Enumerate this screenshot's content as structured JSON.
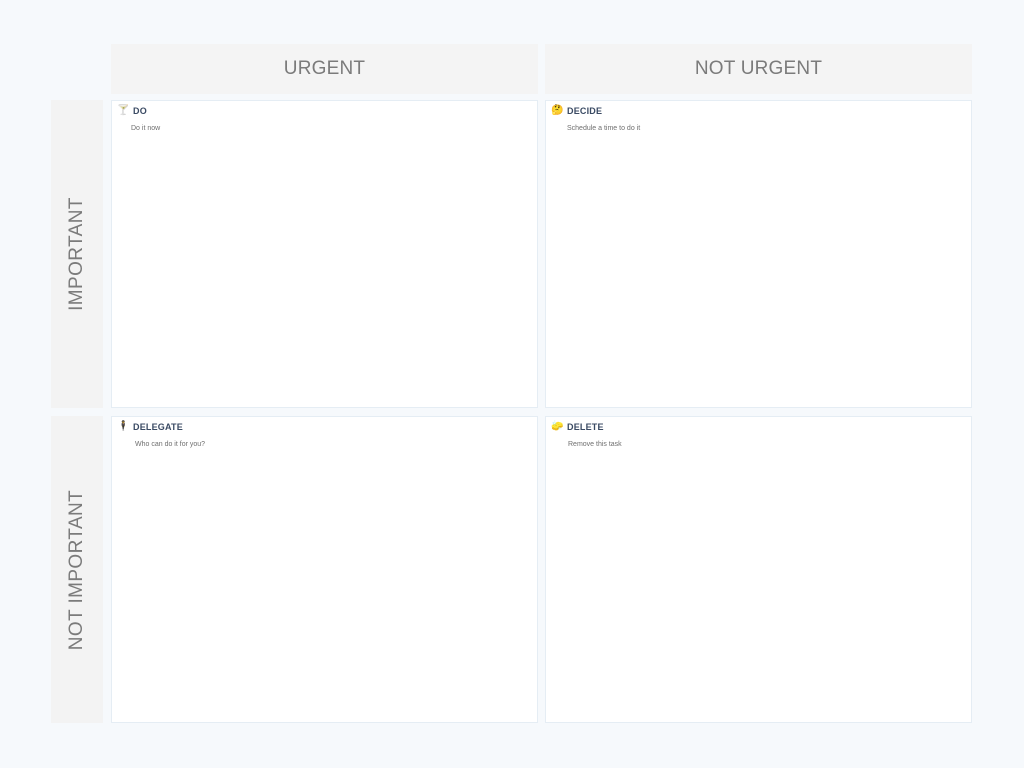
{
  "columns": {
    "urgent": "URGENT",
    "not_urgent": "NOT URGENT"
  },
  "rows": {
    "important": "IMPORTANT",
    "not_important": "NOT IMPORTANT"
  },
  "quadrants": {
    "do": {
      "icon": "cocktail-icon",
      "glyph": "🍸",
      "title": "DO",
      "subtitle": "Do it now"
    },
    "decide": {
      "icon": "thinking-face-icon",
      "glyph": "🤔",
      "title": "DECIDE",
      "subtitle": "Schedule a time to do it"
    },
    "delegate": {
      "icon": "person-icon",
      "glyph": "🕴",
      "title": "DELEGATE",
      "subtitle": "Who can do it for you?"
    },
    "delete": {
      "icon": "eraser-icon",
      "glyph": "🧽",
      "title": "DELETE",
      "subtitle": "Remove this task"
    }
  },
  "colors": {
    "background": "#f6f9fc",
    "header_bg": "#f4f4f4",
    "header_text": "#7b7b7b",
    "quadrant_bg": "#ffffff",
    "title_text": "#3a4a63"
  }
}
